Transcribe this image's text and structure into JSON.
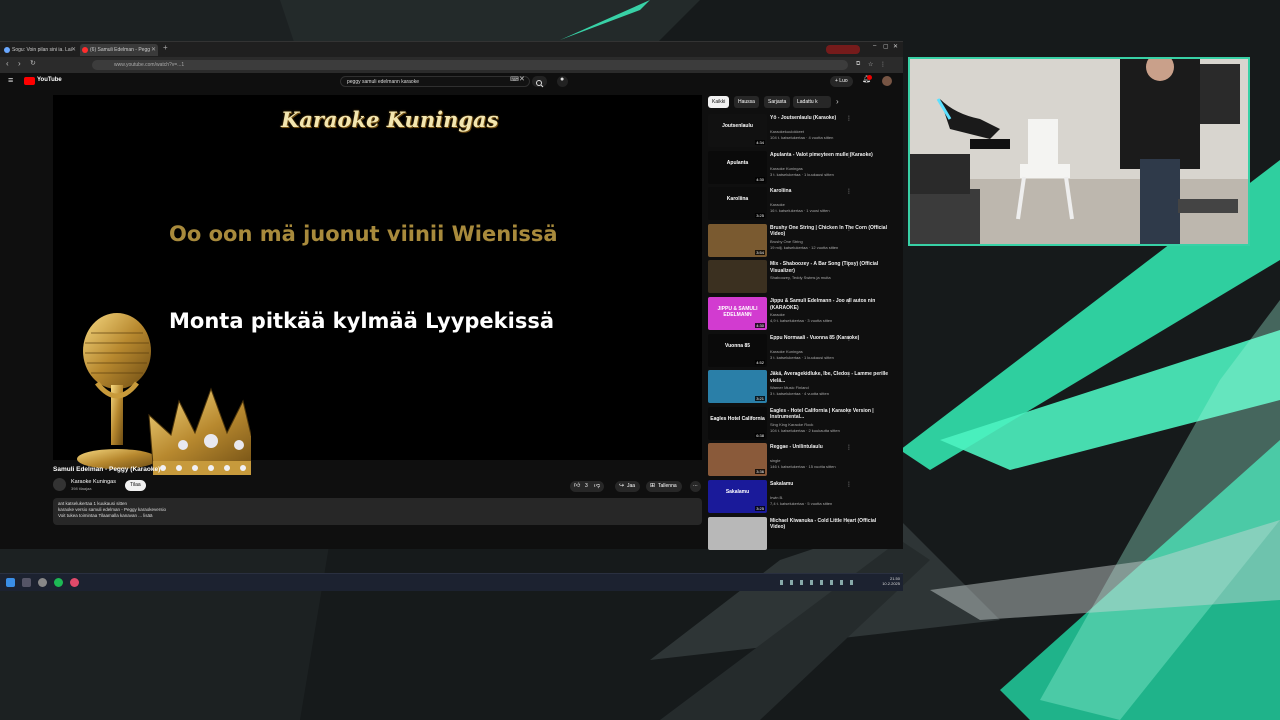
{
  "browser": {
    "tabs": [
      {
        "label": "Sogu: Voin pilan sini ia. Lai"
      },
      {
        "label": "(6) Samuli Edelman - Pegg"
      }
    ],
    "url": "www.youtube.com/watch?v=...1",
    "window_controls": [
      "–",
      "▢",
      "✕"
    ]
  },
  "youtube": {
    "logo_text": "YouTube",
    "search_value": "peggy samuli edelmann karaoke",
    "create_label": "+ Luo",
    "chips": [
      "Kaikki",
      "Haussa",
      "Sarjasta",
      "Ladattu k"
    ],
    "player": {
      "brand": "Karaoke Kuningas",
      "line_upcoming": "Oo oon mä juonut viinii Wienissä",
      "line_current": "Monta pitkää kylmää Lyypekissä"
    },
    "video": {
      "title": "Samuli Edelman - Peggy (Karaoke)",
      "channel": "Karaoke Kuningas",
      "subscribers": "398 tilaajaa",
      "subscribe_label": "Tilaa",
      "likes": "3",
      "share_label": "Jaa",
      "save_label": "Tallenna",
      "more_label": "⋯"
    },
    "description": [
      "ant katselukertaa  1 kuukausi sitten",
      "karaoke versio samuli edelman - Peggy karaokeversio",
      "Voit tukea toimintaa Tilaamalla kanavan ... lisää"
    ],
    "recommendations": [
      {
        "title": "Yö - Joutsenlaulu (Karaoke)",
        "channel": "Karaokekuulokkeet",
        "meta": "104 t. katselukertaa · 4 vuotta sitten",
        "duration": "4:34",
        "thumb_bg": "#111",
        "thumb_text": "Joutsenlaulu"
      },
      {
        "title": "Apulanta - Valot pimeyteen mulle (Karaoke)",
        "channel": "Karaoke Kuningas",
        "meta": "3 t. katselukertaa · 1 kuukausi sitten",
        "duration": "4:30",
        "thumb_bg": "#0a0a0a",
        "thumb_text": "Apulanta"
      },
      {
        "title": "Karoliina",
        "channel": "Karaoke",
        "meta": "16 t. katselukertaa · 1 vuosi sitten",
        "duration": "3:25",
        "thumb_bg": "#0c0c0c",
        "thumb_text": "Karoliina"
      },
      {
        "title": "Brushy One String | Chicken In The Corn (Official Video)",
        "channel": "Brushy One String",
        "meta": "19 milj. katselukertaa · 12 vuotta sitten",
        "duration": "3:54",
        "thumb_bg": "#7a5a30",
        "thumb_text": ""
      },
      {
        "title": "Mix - Shaboozey - A Bar Song (Tipsy) (Official Visualizer)",
        "channel": "Shaboozey, Teddy Swims ja muita",
        "meta": "",
        "duration": "",
        "thumb_bg": "#3b3020",
        "thumb_text": ""
      },
      {
        "title": "Jippu & Samuli Edelmann - Joo all autos nin (KARAOKE)",
        "channel": "Karaoke",
        "meta": "4,9 t. katselukertaa · 3 vuotta sitten",
        "duration": "4:30",
        "thumb_bg": "#d23bd0",
        "thumb_text": "JIPPU & SAMULI EDELMANN"
      },
      {
        "title": "Eppu Normaali - Vuonna 85 (Karaoke)",
        "channel": "Karaoke Kuningas",
        "meta": "3 t. katselukertaa · 1 kuukausi sitten",
        "duration": "4:52",
        "thumb_bg": "#0a0a0a",
        "thumb_text": "Vuonna 85"
      },
      {
        "title": "Jäkä, Averagekidluke, Ibe, Cledos - Lamme perille vielä...",
        "channel": "Warner Music Finland",
        "meta": "3 t. katselukertaa · 4 vuotta sitten",
        "duration": "3:21",
        "thumb_bg": "#2a7fa8",
        "thumb_text": ""
      },
      {
        "title": "Eagles - Hotel California | Karaoke Version | Instrumental...",
        "channel": "Sing King Karaoke Rock",
        "meta": "104 t. katselukertaa · 2 kuukautta sitten",
        "duration": "6:38",
        "thumb_bg": "#0a0a0a",
        "thumb_text": "Eagles Hotel California"
      },
      {
        "title": "Reggae - Unilintulaulu",
        "channel": "single",
        "meta": "146 t. katselukertaa · 15 vuotta sitten",
        "duration": "3:36",
        "thumb_bg": "#8a5a3a",
        "thumb_text": ""
      },
      {
        "title": "Sakalamu",
        "channel": "Irwin B.",
        "meta": "7,4 t. katselukertaa · 5 vuotta sitten",
        "duration": "3:25",
        "thumb_bg": "#1a1a9a",
        "thumb_text": "Sakalamu"
      },
      {
        "title": "Michael Kiwanuka - Cold Little Heart (Official Video)",
        "channel": "",
        "meta": "",
        "duration": "",
        "thumb_bg": "#b8b8b8",
        "thumb_text": ""
      }
    ]
  },
  "taskbar": {
    "clock": "21.50",
    "date": "10.2.2025",
    "colors": {
      "accent": "#38d1a6"
    }
  },
  "scene": {
    "border_color": "#38d1a6",
    "background_accent": "#38d1a6"
  }
}
